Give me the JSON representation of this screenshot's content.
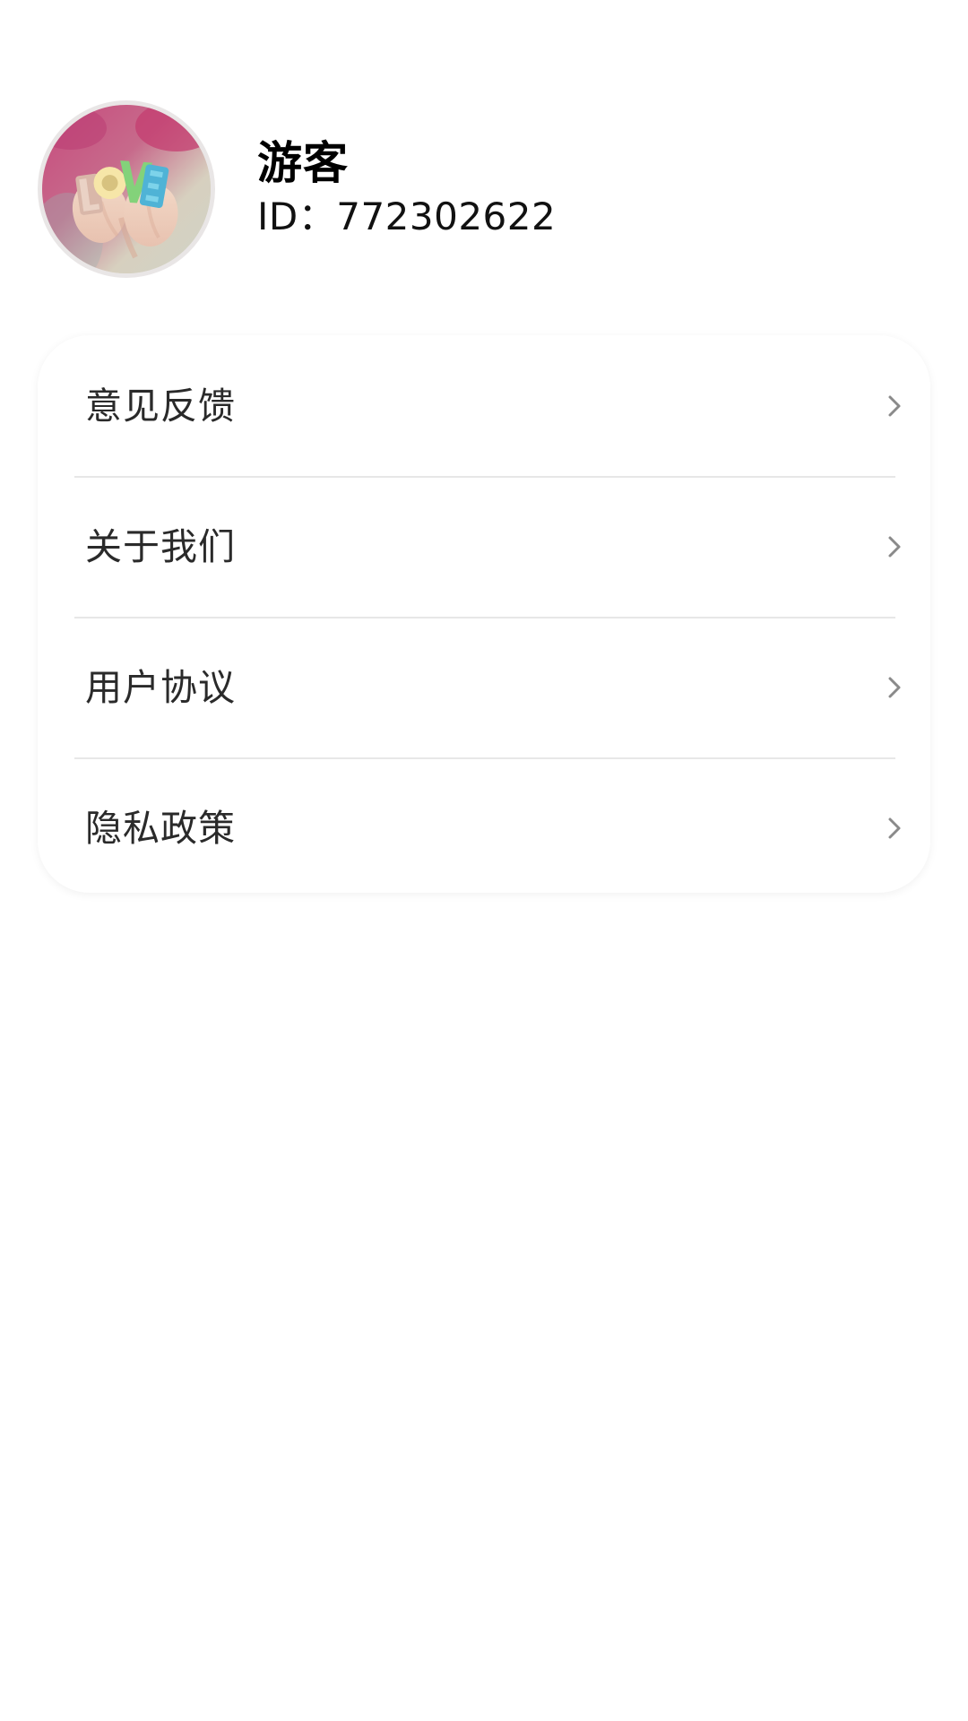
{
  "profile": {
    "name": "游客",
    "id_text": "ID：772302622",
    "avatar_icon": "love-hands-avatar"
  },
  "menu": {
    "items": [
      {
        "label": "意见反馈",
        "icon": "chevron-right-icon"
      },
      {
        "label": "关于我们",
        "icon": "chevron-right-icon"
      },
      {
        "label": "用户协议",
        "icon": "chevron-right-icon"
      },
      {
        "label": "隐私政策",
        "icon": "chevron-right-icon"
      }
    ]
  },
  "colors": {
    "background": "#ffffff",
    "text_primary": "#000000",
    "text_menu": "#2a2a2a",
    "divider": "#e7e7e7",
    "chevron": "#8a8a8a"
  }
}
